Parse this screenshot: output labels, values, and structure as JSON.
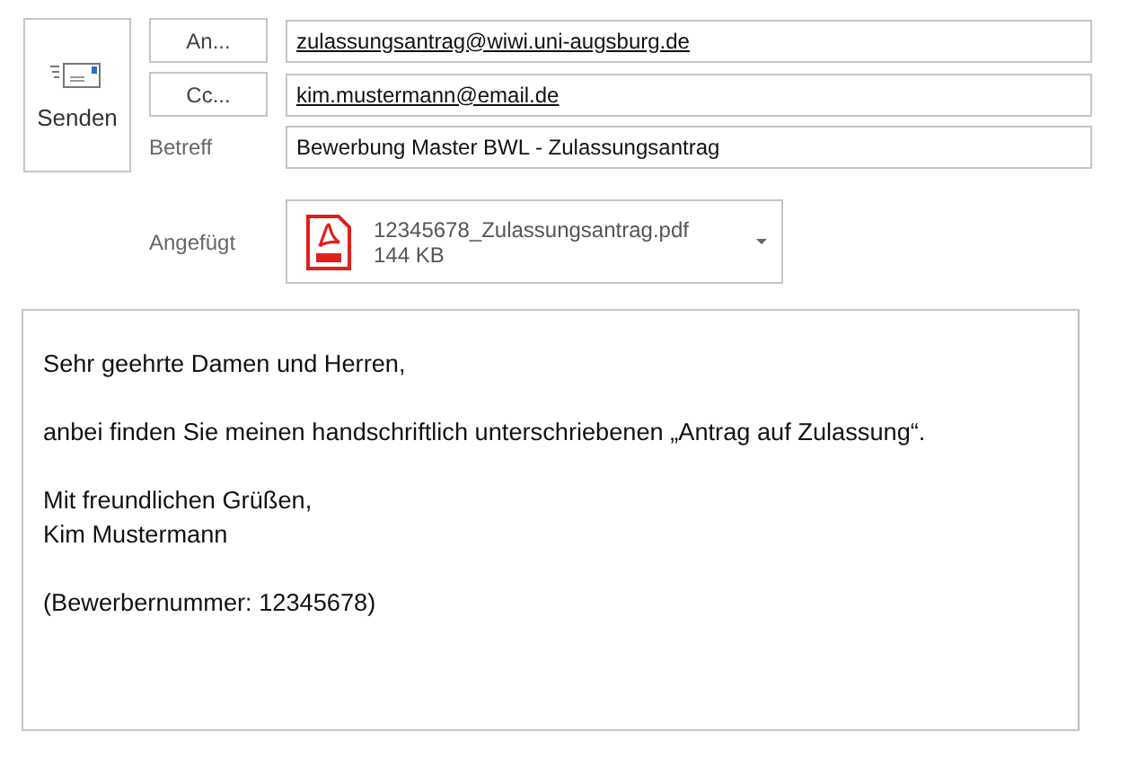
{
  "send_button": {
    "label": "Senden"
  },
  "recipients": [
    {
      "kind": "button",
      "label": "An...",
      "value": "zulassungsantrag@wiwi.uni-augsburg.de"
    },
    {
      "kind": "button",
      "label": "Cc...",
      "value": "kim.mustermann@email.de"
    },
    {
      "kind": "label",
      "label": "Betreff",
      "value": "Bewerbung Master BWL - Zulassungsantrag"
    }
  ],
  "attachment": {
    "label": "Angefügt",
    "file_name": "12345678_Zulassungsantrag.pdf",
    "size": "144 KB"
  },
  "body": {
    "paragraphs": [
      {
        "lines": [
          "Sehr geehrte Damen und Herren,"
        ]
      },
      {
        "lines": [
          "anbei finden Sie meinen handschriftlich unterschriebenen „Antrag auf Zulassung“."
        ]
      },
      {
        "lines": [
          "Mit freundlichen Grüßen,",
          "Kim Mustermann"
        ]
      },
      {
        "lines": [
          "(Bewerbernummer: 12345678)"
        ]
      }
    ]
  }
}
